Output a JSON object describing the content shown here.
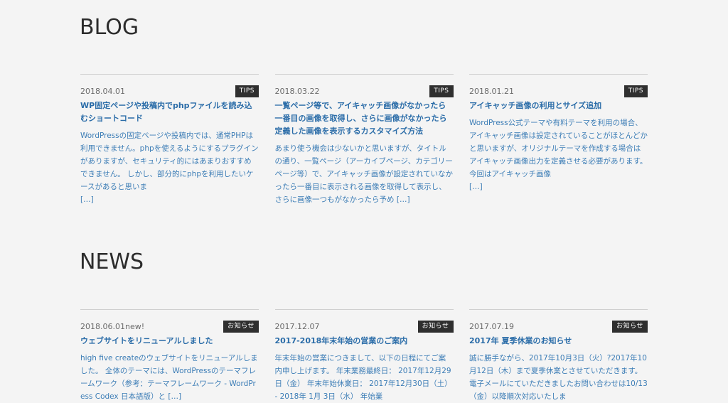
{
  "blog": {
    "heading": "BLOG",
    "posts": [
      {
        "date": "2018.04.01",
        "new_mark": "",
        "tag": "TIPS",
        "title": "WP固定ページや投稿内でphpファイルを読み込むショートコード",
        "excerpt": "WordPressの固定ページや投稿内では、通常PHPは利用できません。phpを使えるようにするプラグインがありますが、セキュリティ的にはあまりおすすめできません。 しかし、部分的にphpを利用したいケースがあると思いま",
        "more": "[…]"
      },
      {
        "date": "2018.03.22",
        "new_mark": "",
        "tag": "TIPS",
        "title": "一覧ページ等で、アイキャッチ画像がなかったら一番目の画像を取得し、さらに画像がなかったら定義した画像を表示するカスタマイズ方法",
        "excerpt": "あまり使う機会は少ないかと思いますが、タイトルの通り、一覧ページ（アーカイブページ、カテゴリーページ等）で、アイキャッチ画像が設定されていなかったら一番目に表示される画像を取得して表示し、さらに画像一つもがなかったら予め",
        "more": "[…]"
      },
      {
        "date": "2018.01.21",
        "new_mark": "",
        "tag": "TIPS",
        "title": "アイキャッチ画像の利用とサイズ追加",
        "excerpt": "WordPress公式テーマや有料テーマを利用の場合、アイキャッチ画像は設定されていることがほとんどかと思いますが、オリジナルテーマを作成する場合はアイキャッチ画像出力を定義させる必要があります。 今回はアイキャッチ画像",
        "more": "[…]"
      }
    ]
  },
  "news": {
    "heading": "NEWS",
    "posts": [
      {
        "date": "2018.06.01",
        "new_mark": "new!",
        "tag": "お知らせ",
        "title": "ウェブサイトをリニューアルしました",
        "excerpt": "high five createのウェブサイトをリニューアルしました。 全体のテーマには、WordPressのテーマフレームワーク（参考：テーマフレームワーク - WordPress Codex 日本語版）と",
        "more": "[…]"
      },
      {
        "date": "2017.12.07",
        "new_mark": "",
        "tag": "お知らせ",
        "title": "2017-2018年末年始の営業のご案内",
        "excerpt": "年末年始の営業につきまして、以下の日程にてご案内申し上げます。 年末業務最終日： 2017年12月29日（金） 年末年始休業日： 2017年12月30日（土） - 2018年 1月 3日（水） 年始業",
        "more": ""
      },
      {
        "date": "2017.07.19",
        "new_mark": "",
        "tag": "お知らせ",
        "title": "2017年 夏季休業のお知らせ",
        "excerpt": "誠に勝手ながら、2017年10月3日（火）?2017年10月12日（木）まで夏季休業とさせていただきます。 電子メールにていただきましたお問い合わせは10/13（金）以降順次対応いたしま",
        "more": ""
      }
    ]
  }
}
